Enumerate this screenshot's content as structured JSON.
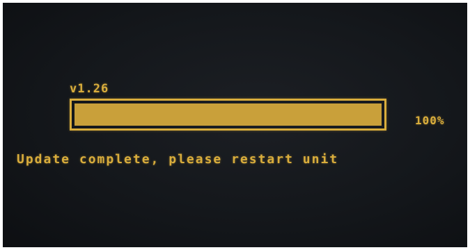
{
  "updater": {
    "version": "v1.26",
    "progress_percent": 100,
    "progress_label": "100%",
    "message": "Update complete, please restart unit"
  },
  "colors": {
    "text": "#d9ad3c",
    "progress_fill": "#c9a03a",
    "background": "#15181c"
  }
}
